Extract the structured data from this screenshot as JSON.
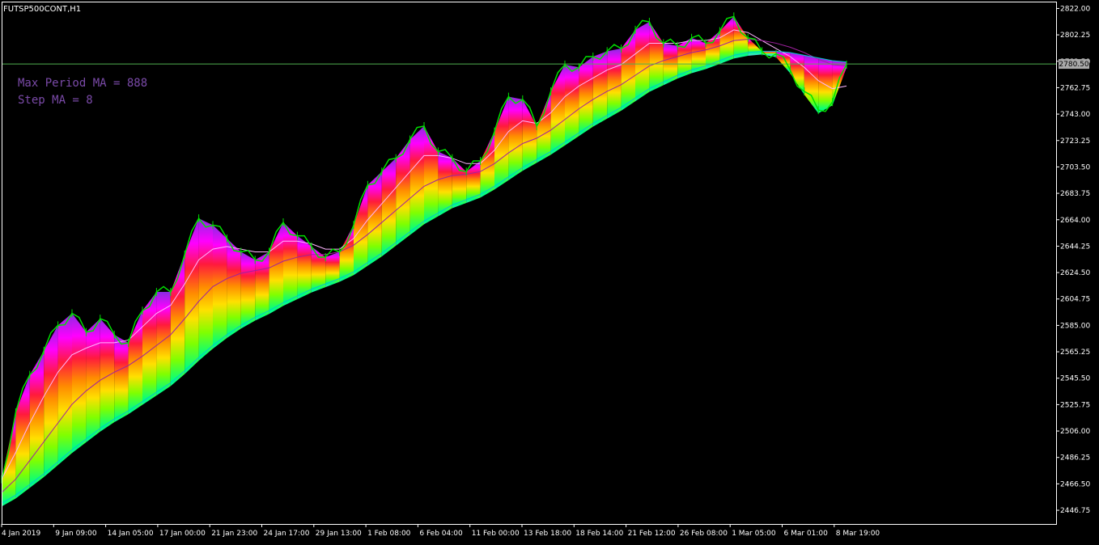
{
  "window": {
    "title": "FUTSP500CONT,H1"
  },
  "annotations": {
    "line1": "Max Period MA = 888",
    "line2": "Step MA = 8"
  },
  "current_price_label": "2780.50",
  "colors": {
    "background": "#000000",
    "frame": "#ffffff",
    "price_line": "#00e000",
    "level_line": "#50b050",
    "annotation_text": "#7a4aa8",
    "price_badge_bg": "#a9a9a9",
    "ma_fast_line": "#ffb6ff",
    "ma_slow_line": "#a020a0",
    "ribbon_gradient": [
      "#8a2be2",
      "#ff00ff",
      "#ff1a3c",
      "#ff8c00",
      "#ffe000",
      "#7fff00",
      "#00ff7f",
      "#40e0d0"
    ]
  },
  "chart_data": {
    "type": "line",
    "symbol": "FUTSP500CONT",
    "timeframe": "H1",
    "ylim": [
      2436.5,
      2826.5
    ],
    "y_ticks": [
      2822.0,
      2802.25,
      2782.5,
      2762.75,
      2743.0,
      2723.25,
      2703.5,
      2683.75,
      2664.0,
      2644.25,
      2624.5,
      2604.75,
      2585.0,
      2565.25,
      2545.5,
      2525.75,
      2506.0,
      2486.25,
      2466.5,
      2446.75
    ],
    "y_tick_labels": [
      "2822.00",
      "2802.25",
      "2782.50",
      "2762.75",
      "2743.00",
      "2723.25",
      "2703.50",
      "2683.75",
      "2664.00",
      "2644.25",
      "2624.50",
      "2604.75",
      "2585.00",
      "2565.25",
      "2545.50",
      "2525.75",
      "2506.00",
      "2486.25",
      "2466.50",
      "2446.75"
    ],
    "x_labels": [
      "4 Jan 2019",
      "9 Jan 09:00",
      "14 Jan 05:00",
      "17 Jan 00:00",
      "21 Jan 23:00",
      "24 Jan 17:00",
      "29 Jan 13:00",
      "1 Feb 08:00",
      "6 Feb 04:00",
      "11 Feb 00:00",
      "13 Feb 18:00",
      "18 Feb 14:00",
      "21 Feb 12:00",
      "26 Feb 08:00",
      "1 Mar 05:00",
      "6 Mar 01:00",
      "8 Mar 19:00"
    ],
    "current_level": 2780.5,
    "series": [
      {
        "values": [
          2470,
          2520,
          2548,
          2566,
          2585,
          2594,
          2580,
          2590,
          2578,
          2572,
          2596,
          2610,
          2610,
          2638,
          2665,
          2660,
          2650,
          2640,
          2634,
          2640,
          2662,
          2652,
          2644,
          2636,
          2640,
          2660,
          2690,
          2700,
          2710,
          2724,
          2734,
          2715,
          2710,
          2700,
          2708,
          2730,
          2756,
          2754,
          2734,
          2760,
          2780,
          2778,
          2786,
          2790,
          2792,
          2806,
          2812,
          2796,
          2794,
          2800,
          2796,
          2805,
          2816,
          2800,
          2790,
          2788,
          2776,
          2760,
          2746,
          2752,
          2780
        ]
      }
    ],
    "ribbon_ma_series": [
      {
        "values": [
          2470,
          2490,
          2512,
          2532,
          2550,
          2563,
          2568,
          2572,
          2572,
          2574,
          2584,
          2594,
          2600,
          2616,
          2634,
          2642,
          2644,
          2642,
          2640,
          2640,
          2648,
          2648,
          2646,
          2642,
          2642,
          2650,
          2664,
          2676,
          2688,
          2700,
          2712,
          2712,
          2710,
          2706,
          2706,
          2716,
          2730,
          2738,
          2736,
          2744,
          2756,
          2764,
          2770,
          2776,
          2780,
          2788,
          2796,
          2796,
          2796,
          2798,
          2798,
          2800,
          2806,
          2804,
          2798,
          2792,
          2786,
          2778,
          2768,
          2762,
          2764
        ]
      },
      {
        "values": [
          2460,
          2470,
          2484,
          2498,
          2512,
          2526,
          2536,
          2544,
          2550,
          2555,
          2562,
          2570,
          2578,
          2590,
          2603,
          2614,
          2620,
          2624,
          2626,
          2628,
          2633,
          2636,
          2638,
          2638,
          2640,
          2645,
          2653,
          2662,
          2671,
          2680,
          2689,
          2694,
          2697,
          2698,
          2700,
          2706,
          2714,
          2721,
          2725,
          2731,
          2739,
          2747,
          2754,
          2760,
          2765,
          2772,
          2779,
          2783,
          2786,
          2789,
          2791,
          2794,
          2798,
          2799,
          2798,
          2796,
          2793,
          2789,
          2784,
          2780,
          2779
        ]
      },
      {
        "values": [
          2452,
          2458,
          2466,
          2474,
          2483,
          2492,
          2500,
          2508,
          2515,
          2521,
          2528,
          2535,
          2542,
          2551,
          2561,
          2570,
          2578,
          2585,
          2591,
          2596,
          2602,
          2607,
          2612,
          2616,
          2620,
          2625,
          2632,
          2639,
          2647,
          2655,
          2663,
          2669,
          2675,
          2679,
          2683,
          2689,
          2696,
          2703,
          2709,
          2715,
          2722,
          2729,
          2736,
          2742,
          2748,
          2755,
          2762,
          2767,
          2772,
          2776,
          2779,
          2783,
          2787,
          2789,
          2790,
          2790,
          2789,
          2787,
          2785,
          2783,
          2782
        ]
      }
    ],
    "grid": false,
    "legend": "none"
  }
}
